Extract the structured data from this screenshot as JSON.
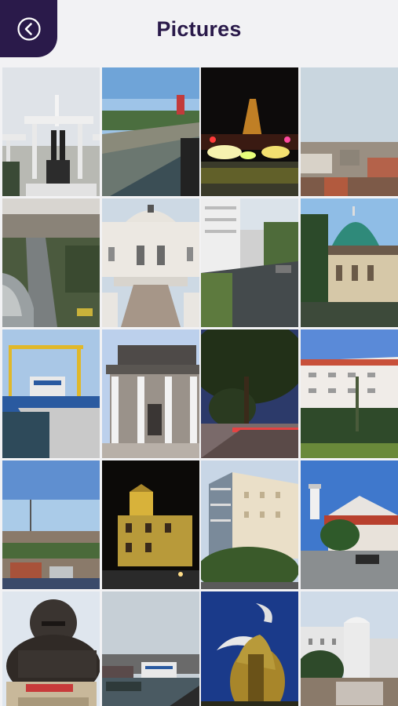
{
  "header": {
    "title": "Pictures",
    "back_icon": "back-arrow-circle-icon",
    "back_color": "#2a1a4a"
  },
  "gallery": {
    "tiles": [
      {
        "name": "monument-statue-photo"
      },
      {
        "name": "river-canal-photo"
      },
      {
        "name": "night-fountain-photo"
      },
      {
        "name": "city-skyline-photo"
      },
      {
        "name": "aerial-road-photo"
      },
      {
        "name": "colonial-building-photo"
      },
      {
        "name": "street-view-photo"
      },
      {
        "name": "green-dome-mosque-photo"
      },
      {
        "name": "harbor-crane-photo"
      },
      {
        "name": "museum-building-photo"
      },
      {
        "name": "tree-lit-street-photo"
      },
      {
        "name": "hotel-building-photo"
      },
      {
        "name": "city-panorama-photo"
      },
      {
        "name": "night-tower-building-photo"
      },
      {
        "name": "apartment-building-photo"
      },
      {
        "name": "mosque-tower-photo"
      },
      {
        "name": "gorilla-statue-photo"
      },
      {
        "name": "port-boats-photo"
      },
      {
        "name": "fish-crocodile-statue-photo"
      },
      {
        "name": "white-dome-building-photo"
      }
    ]
  }
}
